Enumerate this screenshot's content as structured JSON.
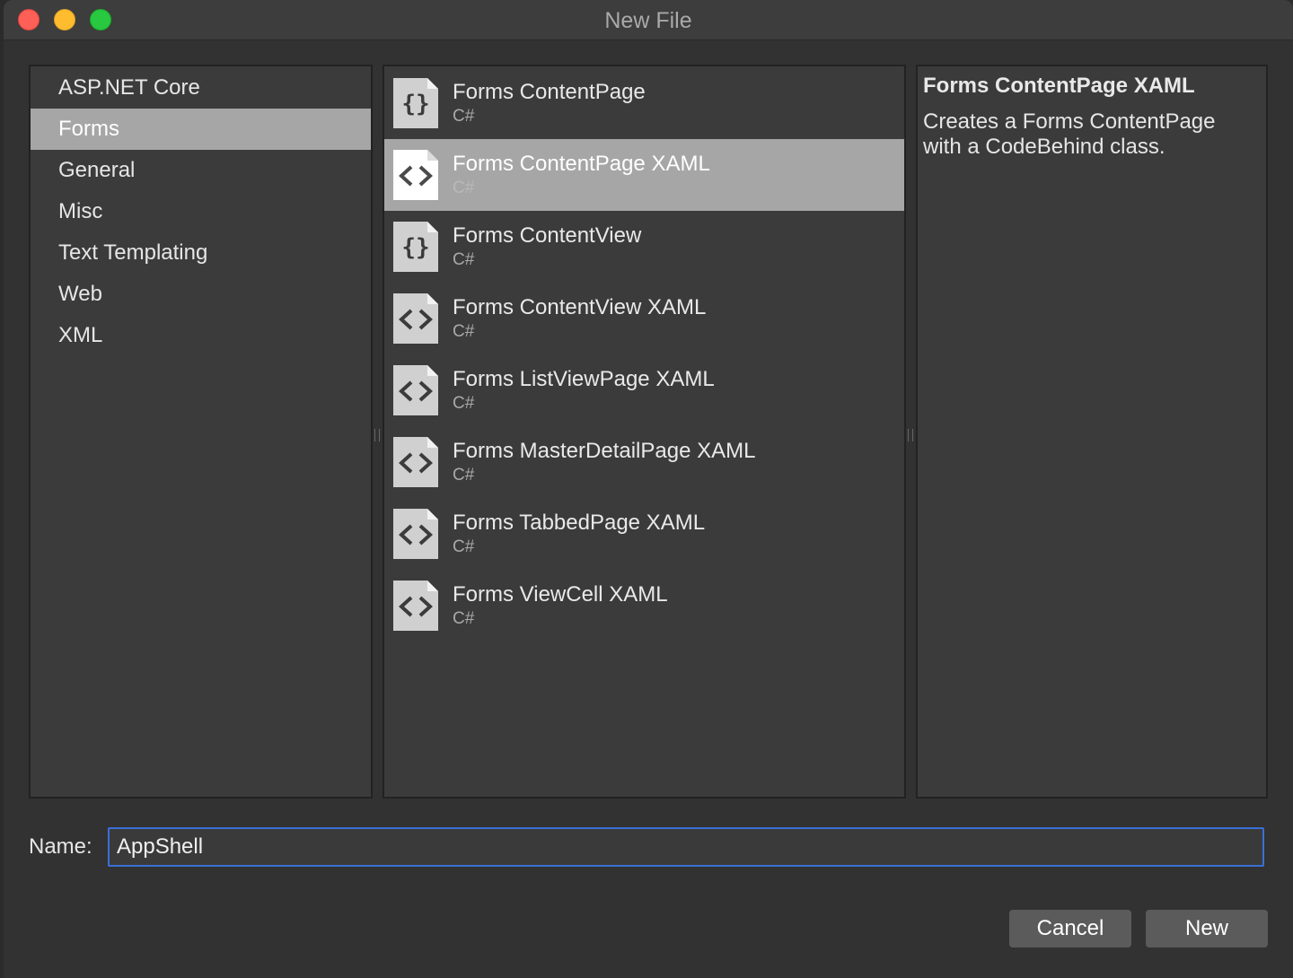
{
  "window": {
    "title": "New File"
  },
  "categories": [
    {
      "label": "ASP.NET Core",
      "selected": false
    },
    {
      "label": "Forms",
      "selected": true
    },
    {
      "label": "General",
      "selected": false
    },
    {
      "label": "Misc",
      "selected": false
    },
    {
      "label": "Text Templating",
      "selected": false
    },
    {
      "label": "Web",
      "selected": false
    },
    {
      "label": "XML",
      "selected": false
    }
  ],
  "templates": [
    {
      "name": "Forms ContentPage",
      "lang": "C#",
      "icon": "braces-file-icon",
      "selected": false
    },
    {
      "name": "Forms ContentPage XAML",
      "lang": "C#",
      "icon": "code-file-icon",
      "selected": true
    },
    {
      "name": "Forms ContentView",
      "lang": "C#",
      "icon": "braces-file-icon",
      "selected": false
    },
    {
      "name": "Forms ContentView XAML",
      "lang": "C#",
      "icon": "code-file-icon",
      "selected": false
    },
    {
      "name": "Forms ListViewPage XAML",
      "lang": "C#",
      "icon": "code-file-icon",
      "selected": false
    },
    {
      "name": "Forms MasterDetailPage XAML",
      "lang": "C#",
      "icon": "code-file-icon",
      "selected": false
    },
    {
      "name": "Forms TabbedPage XAML",
      "lang": "C#",
      "icon": "code-file-icon",
      "selected": false
    },
    {
      "name": "Forms ViewCell XAML",
      "lang": "C#",
      "icon": "code-file-icon",
      "selected": false
    }
  ],
  "description": {
    "title": "Forms ContentPage XAML",
    "text": "Creates a Forms ContentPage with a CodeBehind class."
  },
  "name_field": {
    "label": "Name:",
    "value": "AppShell"
  },
  "buttons": {
    "cancel": "Cancel",
    "new": "New"
  },
  "colors": {
    "selection": "#a6a6a6",
    "focus": "#3b6fd8",
    "button": "#5b5b5b"
  }
}
